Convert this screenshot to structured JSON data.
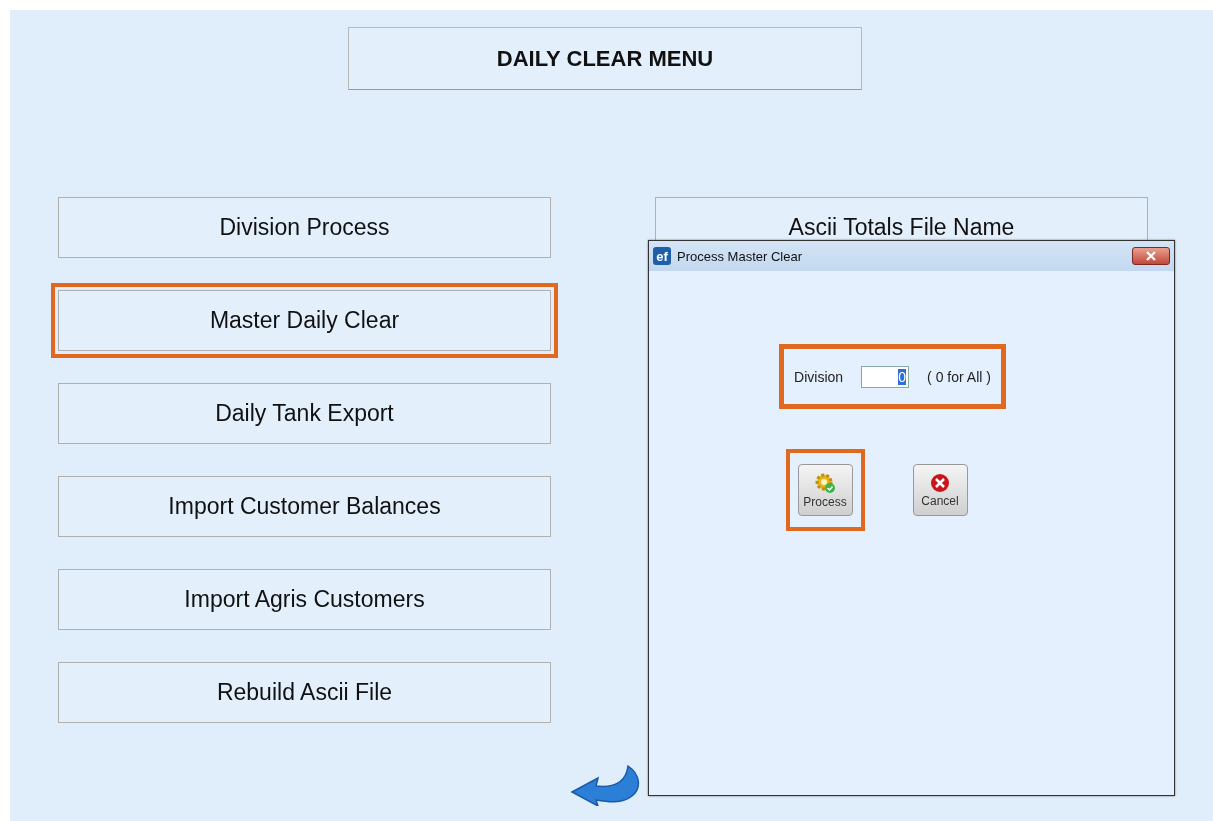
{
  "title": "DAILY CLEAR MENU",
  "menu_items": [
    {
      "label": "Division Process",
      "highlighted": false
    },
    {
      "label": "Master Daily Clear",
      "highlighted": true
    },
    {
      "label": "Daily Tank Export",
      "highlighted": false
    },
    {
      "label": "Import Customer Balances",
      "highlighted": false
    },
    {
      "label": "Import Agris Customers",
      "highlighted": false
    },
    {
      "label": "Rebuild Ascii File",
      "highlighted": false
    }
  ],
  "side_button": {
    "label": "Ascii Totals File Name"
  },
  "dialog": {
    "app_icon_text": "ef",
    "title": "Process Master Clear",
    "field": {
      "label": "Division",
      "value": "0",
      "value_selected": true,
      "hint": "( 0 for All )",
      "highlighted": true
    },
    "buttons": [
      {
        "kind": "process",
        "label": "Process",
        "highlighted": true
      },
      {
        "kind": "cancel",
        "label": "Cancel",
        "highlighted": false
      }
    ]
  }
}
